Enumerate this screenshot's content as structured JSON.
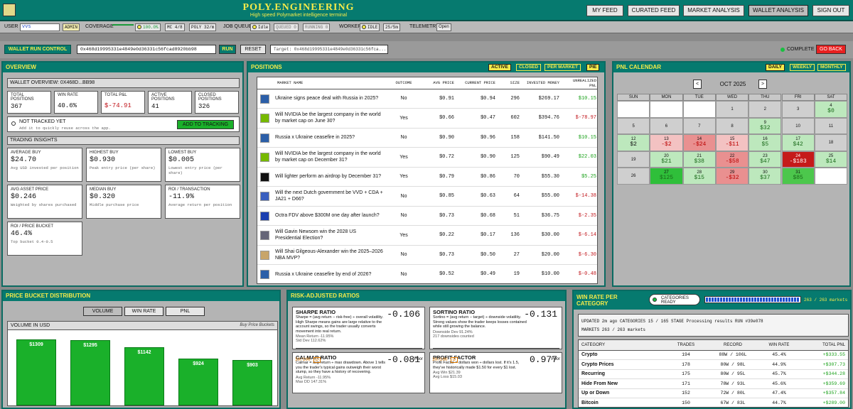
{
  "header": {
    "brand": "POLY.ENGINEERING",
    "tagline": "High speed Polymarket intelligence terminal",
    "nav": [
      "MY FEED",
      "CURATED FEED",
      "MARKET ANALYSIS",
      "WALLET ANALYSIS",
      "SIGN OUT"
    ],
    "active_nav": "WALLET ANALYSIS"
  },
  "status": {
    "user_label": "USER",
    "user_value": "vvs",
    "admin": "ADMIN",
    "coverage_label": "COVERAGE",
    "coverage_pct": "100.0%",
    "mc": "MC 4/8",
    "poly": "POLY 32/m",
    "job_label": "JOB QUEUE",
    "idle": "Idle",
    "queued": "QUEUED 0",
    "running": "RUNNING 0",
    "worker_label": "WORKER",
    "worker_idle": "IDLE",
    "worker_rate": "25/5m",
    "telemetry_label": "TELEMETRY",
    "telemetry_value": "Open"
  },
  "run": {
    "title": "WALLET RUN CONTROL",
    "address": "0x468d19995331e4849e0d36331c56fcad8920bb98",
    "run": "RUN",
    "reset": "RESET",
    "target": "Target: 0x468d19995331e4849e0d36331c56fca...",
    "complete": "COMPLETE",
    "go_back": "GO BACK"
  },
  "overview": {
    "title": "OVERVIEW",
    "wallet": "WALLET OVERVIEW: 0X468D...BB98",
    "stats": [
      {
        "l1": "TOTAL",
        "l2": "POSITIONS",
        "v": "367",
        "c": ""
      },
      {
        "l1": "WIN RATE",
        "l2": "",
        "v": "40.6%",
        "c": ""
      },
      {
        "l1": "TOTAL P&L",
        "l2": "",
        "v": "$-74.91",
        "c": "red"
      },
      {
        "l1": "ACTIVE",
        "l2": "POSITIONS",
        "v": "41",
        "c": ""
      },
      {
        "l1": "CLOSED",
        "l2": "POSITIONS",
        "v": "326",
        "c": ""
      }
    ],
    "not_tracked": "NOT TRACKED YET",
    "not_tracked_sub": "Add it to quickly reuse across the app.",
    "add_tracking": "ADD TO TRACKING",
    "insights_title": "TRADING INSIGHTS",
    "insights": [
      {
        "l": "AVERAGE BUY",
        "v": "$24.70",
        "s": "Avg USD invested per position"
      },
      {
        "l": "HIGHEST BUY",
        "v": "$0.930",
        "s": "Peak entry price (per share)"
      },
      {
        "l": "LOWEST BUY",
        "v": "$0.005",
        "s": "Lowest entry price (per share)"
      },
      {
        "l": "AVG ASSET PRICE",
        "v": "$0.246",
        "s": "Weighted by shares purchased"
      },
      {
        "l": "MEDIAN BUY",
        "v": "$0.320",
        "s": "Middle purchase price"
      },
      {
        "l": "ROI / TRANSACTION",
        "v": "-11.9%",
        "s": "Average return per position"
      },
      {
        "l": "ROI / PRICE BUCKET",
        "v": "46.4%",
        "s": "Top bucket 0.4-0.5"
      }
    ]
  },
  "positions": {
    "title": "POSITIONS",
    "tabs": [
      "ACTIVE",
      "CLOSED",
      "PER MARKET",
      "PIE"
    ],
    "headers": [
      "MARKET NAME",
      "OUTCOME",
      "AVG PRICE",
      "CURRENT PRICE",
      "SIZE",
      "INVESTED MONEY",
      "UNREALIZED PNL"
    ],
    "rows": [
      {
        "m": "Ukraine signs peace deal with Russia in 2025?",
        "o": "No",
        "a": "$0.91",
        "c": "$0.94",
        "s": "296",
        "i": "$269.17",
        "p": "$10.15",
        "pc": "grn",
        "ic": "#2c5fa8"
      },
      {
        "m": "Will NVIDIA be the largest company in the world by market cap on June 30?",
        "o": "Yes",
        "a": "$0.66",
        "c": "$0.47",
        "s": "602",
        "i": "$394.76",
        "p": "$-78.97",
        "pc": "red",
        "ic": "#76b900"
      },
      {
        "m": "Russia x Ukraine ceasefire in 2025?",
        "o": "No",
        "a": "$0.90",
        "c": "$0.96",
        "s": "158",
        "i": "$141.50",
        "p": "$10.15",
        "pc": "grn",
        "ic": "#2c5fa8"
      },
      {
        "m": "Will NVIDIA be the largest company in the world by market cap on December 31?",
        "o": "Yes",
        "a": "$0.72",
        "c": "$0.90",
        "s": "125",
        "i": "$90.49",
        "p": "$22.03",
        "pc": "grn",
        "ic": "#76b900"
      },
      {
        "m": "Will lighter perform an airdrop by December 31?",
        "o": "Yes",
        "a": "$0.79",
        "c": "$0.86",
        "s": "70",
        "i": "$55.30",
        "p": "$5.25",
        "pc": "grn",
        "ic": "#111"
      },
      {
        "m": "Will the next Dutch government be VVD + CDA + JA21 + D66?",
        "o": "No",
        "a": "$0.85",
        "c": "$0.63",
        "s": "64",
        "i": "$55.00",
        "p": "$-14.38",
        "pc": "red",
        "ic": "#3a5fbf"
      },
      {
        "m": "Octra FDV above $300M one day after launch?",
        "o": "No",
        "a": "$0.73",
        "c": "$0.68",
        "s": "51",
        "i": "$36.75",
        "p": "$-2.35",
        "pc": "red",
        "ic": "#1b3fb0"
      },
      {
        "m": "Will Gavin Newsom win the 2028 US Presidential Election?",
        "o": "Yes",
        "a": "$0.22",
        "c": "$0.17",
        "s": "136",
        "i": "$30.00",
        "p": "$-6.14",
        "pc": "red",
        "ic": "#667"
      },
      {
        "m": "Will Shai Gilgeous-Alexander win the 2025–2026 NBA MVP?",
        "o": "No",
        "a": "$0.73",
        "c": "$0.50",
        "s": "27",
        "i": "$20.00",
        "p": "$-6.30",
        "pc": "red",
        "ic": "#c8a56a"
      },
      {
        "m": "Russia x Ukraine ceasefire by end of 2026?",
        "o": "No",
        "a": "$0.52",
        "c": "$0.49",
        "s": "19",
        "i": "$10.00",
        "p": "$-0.48",
        "pc": "red",
        "ic": "#2c5fa8"
      }
    ]
  },
  "pnl": {
    "title": "PNL CALENDAR",
    "tabs": [
      "DAILY",
      "WEEKLY",
      "MONTHLY"
    ],
    "month": "OCT 2025",
    "prev": "<",
    "next": ">",
    "days": [
      "SUN",
      "MON",
      "TUE",
      "WED",
      "THU",
      "FRI",
      "SAT"
    ],
    "weeks": [
      {
        "wk": "",
        "cells": [
          {
            "d": "",
            "v": "",
            "c": "w"
          },
          {
            "d": "",
            "v": "",
            "c": "w"
          },
          {
            "d": "",
            "v": "",
            "c": "w"
          },
          {
            "d": "1",
            "v": "",
            "c": "g"
          },
          {
            "d": "2",
            "v": "",
            "c": "g"
          },
          {
            "d": "3",
            "v": "",
            "c": "g"
          },
          {
            "d": "4",
            "v": "$0",
            "c": "lg"
          }
        ]
      },
      {
        "wk": "5",
        "cells": [
          {
            "d": "6",
            "v": "",
            "c": "g"
          },
          {
            "d": "7",
            "v": "",
            "c": "g"
          },
          {
            "d": "8",
            "v": "",
            "c": "g"
          },
          {
            "d": "9",
            "v": "$32",
            "c": "lg"
          },
          {
            "d": "10",
            "v": "",
            "c": "g"
          },
          {
            "d": "11",
            "v": "",
            "c": "g"
          }
        ]
      },
      {
        "wk": "12",
        "wv": "$2",
        "cells": [
          {
            "d": "13",
            "v": "-$2",
            "c": "lr"
          },
          {
            "d": "14",
            "v": "-$24",
            "c": "mr"
          },
          {
            "d": "15",
            "v": "-$11",
            "c": "lr"
          },
          {
            "d": "16",
            "v": "$5",
            "c": "lg"
          },
          {
            "d": "17",
            "v": "$42",
            "c": "lg"
          },
          {
            "d": "18",
            "v": "",
            "c": "g"
          }
        ]
      },
      {
        "wk": "19",
        "cells": [
          {
            "d": "20",
            "v": "$21",
            "c": "lg"
          },
          {
            "d": "21",
            "v": "$38",
            "c": "lg"
          },
          {
            "d": "22",
            "v": "-$58",
            "c": "mr"
          },
          {
            "d": "23",
            "v": "$47",
            "c": "lg"
          },
          {
            "d": "24",
            "v": "-$183",
            "c": "dr"
          },
          {
            "d": "25",
            "v": "$14",
            "c": "lg"
          }
        ]
      },
      {
        "wk": "26",
        "cells": [
          {
            "d": "27",
            "v": "$125",
            "c": "dg"
          },
          {
            "d": "28",
            "v": "$15",
            "c": "lg"
          },
          {
            "d": "29",
            "v": "-$32",
            "c": "mr"
          },
          {
            "d": "30",
            "v": "$37",
            "c": "lg"
          },
          {
            "d": "31",
            "v": "$85",
            "c": "mg"
          },
          {
            "d": "",
            "v": "",
            "c": "w"
          }
        ]
      }
    ]
  },
  "buckets": {
    "title": "PRICE BUCKET DISTRIBUTION",
    "tabs": [
      "VOLUME",
      "WIN RATE",
      "PNL"
    ],
    "sub_title": "VOLUME IN USD",
    "sub_right": "Buy Price Buckets",
    "bars": [
      {
        "label": "$1309",
        "value": 1309
      },
      {
        "label": "$1295",
        "value": 1295
      },
      {
        "label": "$1142",
        "value": 1142
      },
      {
        "label": "$924",
        "value": 924
      },
      {
        "label": "$903",
        "value": 903
      }
    ]
  },
  "ratios": {
    "title": "RISK-ADJUSTED RATIOS",
    "cards": [
      {
        "name": "SHARPE RATIO",
        "value": "-0.106",
        "desc": "Sharpe = (avg return − risk-free) ÷ overall volatility. High Sharpe means gains are large relative to the account swings, so the trader usually converts movement into real return.",
        "l1": "Mean Return -11.95%",
        "l2": "Std Dev 112.62%",
        "score": "30/100",
        "grade": "D",
        "rating": "Poor",
        "fill": 0.3
      },
      {
        "name": "SORTINO RATIO",
        "value": "-0.131",
        "desc": "Sortino = (avg return − target) ÷ downside volatility. Strong values show the trader keeps losses contained while still growing the balance.",
        "l1": "Downside Dev 91.24%",
        "l2": "217 downsides counted",
        "score": "30/100",
        "grade": "D",
        "rating": "Poor",
        "fill": 0.3
      },
      {
        "name": "CALMAR RATIO",
        "value": "-0.081",
        "desc": "Calmar = avg return ÷ max drawdown. Above 1 tells you the trader's typical gains outweigh their worst slump, so they have a history of recovering.",
        "l1": "Avg Return -11.95%",
        "l2": "Max DD 147.31%",
        "score": "",
        "grade": "",
        "rating": "",
        "fill": 0
      },
      {
        "name": "PROFIT FACTOR",
        "value": "0.977",
        "desc": "Profit Factor = dollars won ÷ dollars lost. If it's 1.5, they've historically made $1.50 for every $1 lost.",
        "l1": "Avg Win $21.39",
        "l2": "Avg Loss $15.03",
        "score": "",
        "grade": "",
        "rating": "",
        "fill": 0
      }
    ]
  },
  "winrate": {
    "title1": "WIN RATE PER",
    "title2": "CATEGORY",
    "ready1": "CATEGORIES",
    "ready2": "READY",
    "progress": "263 / 263 markets",
    "progress_frac": 1.0,
    "info1": "UPDATED 2m ago  CATEGORIES 15 / 165  STAGE Processing results  RUN #39e078",
    "info2": "MARKETS 263 / 263 markets",
    "headers": [
      "CATEGORY",
      "TRADES",
      "RECORD",
      "WIN RATE",
      "TOTAL PNL"
    ],
    "rows": [
      {
        "c": "Crypto",
        "t": "194",
        "r": "88W / 106L",
        "w": "45.4%",
        "p": "+$333.55"
      },
      {
        "c": "Crypto Prices",
        "t": "178",
        "r": "80W / 98L",
        "w": "44.9%",
        "p": "+$307.73"
      },
      {
        "c": "Recurring",
        "t": "175",
        "r": "80W / 95L",
        "w": "45.7%",
        "p": "+$344.28"
      },
      {
        "c": "Hide From New",
        "t": "171",
        "r": "78W / 93L",
        "w": "45.6%",
        "p": "+$359.69"
      },
      {
        "c": "Up or Down",
        "t": "152",
        "r": "72W / 80L",
        "w": "47.4%",
        "p": "+$357.84"
      },
      {
        "c": "Bitcoin",
        "t": "150",
        "r": "67W / 83L",
        "w": "44.7%",
        "p": "+$289.00"
      }
    ]
  },
  "colors": {
    "teal": "#067a6f",
    "yellow": "#f5ea4a",
    "red": "#c0141a",
    "green": "#18a018"
  }
}
